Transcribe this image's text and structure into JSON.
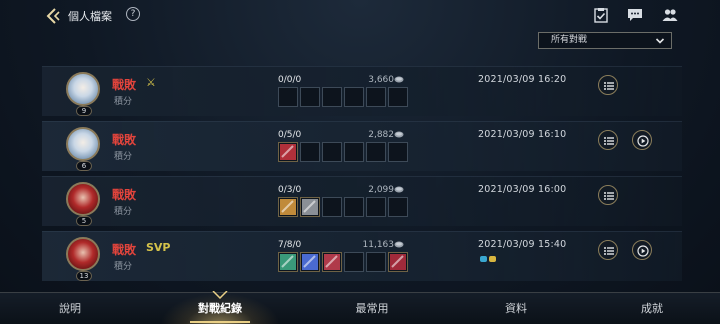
{
  "header": {
    "title": "個人檔案",
    "help": "?",
    "filter_value": "所有對戰",
    "top_icons": [
      "checklist-icon",
      "chat-icon",
      "friends-icon"
    ]
  },
  "matches": [
    {
      "result": "戰敗",
      "badge": "⚔",
      "mode": "積分",
      "level": "9",
      "champion_style": "blue",
      "kda": "0/0/0",
      "gold": "3,660",
      "items": [],
      "time": "2021/03/09 16:20",
      "has_replay": false
    },
    {
      "result": "戰敗",
      "badge": "",
      "mode": "積分",
      "level": "6",
      "champion_style": "blue",
      "kda": "0/5/0",
      "gold": "2,882",
      "items": [
        "#b0303a"
      ],
      "time": "2021/03/09 16:10",
      "has_replay": true
    },
    {
      "result": "戰敗",
      "badge": "",
      "mode": "積分",
      "level": "5",
      "champion_style": "red",
      "kda": "0/3/0",
      "gold": "2,099",
      "items": [
        "#c08a3a",
        "#8a8f96"
      ],
      "time": "2021/03/09 16:00",
      "has_replay": false
    },
    {
      "result": "戰敗",
      "badge": "SVP",
      "mode": "積分",
      "level": "13",
      "champion_style": "red",
      "kda": "7/8/0",
      "gold": "11,163",
      "items": [
        "#3a9a7a",
        "#4a6ad0",
        "#b03a4a",
        "",
        "",
        "#a02a3a"
      ],
      "time": "2021/03/09 15:40",
      "has_replay": true
    }
  ],
  "tabs": [
    {
      "label": "說明",
      "active": false
    },
    {
      "label": "對戰紀錄",
      "active": true
    },
    {
      "label": "最常用",
      "active": false
    },
    {
      "label": "資料",
      "active": false
    },
    {
      "label": "成就",
      "active": false
    }
  ],
  "colors": {
    "defeat": "#e2443c",
    "accent_gold": "#e9cf86",
    "svp": "#d4c24a"
  }
}
